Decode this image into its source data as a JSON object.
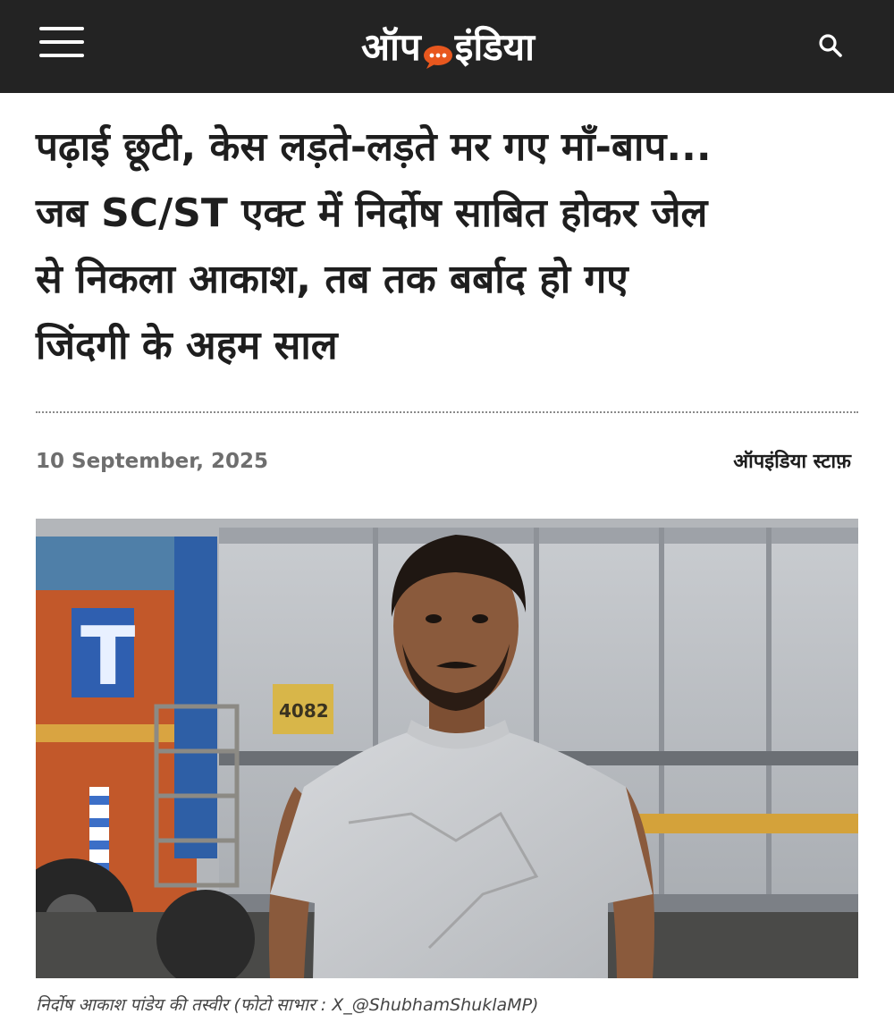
{
  "header": {
    "logo_text_left": "ऑप",
    "logo_text_right": "इंडिया",
    "brand_color": "#e8571e",
    "menu_icon": "hamburger-menu-icon",
    "search_icon": "search-icon"
  },
  "article": {
    "title_lines": [
      "पढ़ाई छूटी, केस लड़ते-लड़ते मर गए माँ-बाप...",
      "जब SC/ST एक्ट में निर्दोष साबित होकर जेल",
      "से निकला आकाश, तब तक बर्बाद हो गए",
      "जिंदगी के अहम साल"
    ],
    "date": "10 September, 2025",
    "author": "ऑपइंडिया स्टाफ़",
    "image_caption": "निर्दोष आकाश पांडेय की तस्वीर (फोटो साभार : X_@ShubhamShuklaMP)"
  }
}
